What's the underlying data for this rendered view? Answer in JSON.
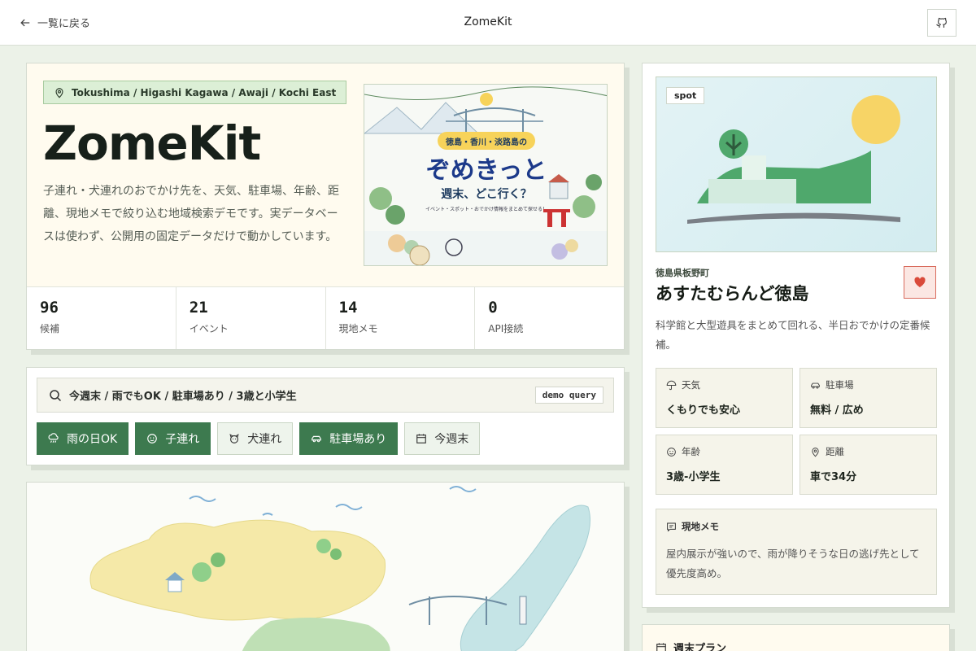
{
  "topbar": {
    "back_label": "一覧に戻る",
    "title": "ZomeKit"
  },
  "hero": {
    "region": "Tokushima / Higashi Kagawa / Awaji / Kochi East",
    "brand": "ZomeKit",
    "intro": "子連れ・犬連れのおでかけ先を、天気、駐車場、年齢、距離、現地メモで絞り込む地域検索デモです。実データベースは使わず、公開用の固定データだけで動かしています。",
    "art": {
      "badge": "徳島・香川・淡路島の",
      "title": "ぞめきっと",
      "subtitle": "週末、どこ行く？",
      "caption": "イベント・スポット・おでかけ情報をまとめて探せる！"
    },
    "stats": [
      {
        "value": "96",
        "label": "候補"
      },
      {
        "value": "21",
        "label": "イベント"
      },
      {
        "value": "14",
        "label": "現地メモ"
      },
      {
        "value": "0",
        "label": "API接続"
      }
    ]
  },
  "search": {
    "query": "今週末 / 雨でもOK / 駐車場あり / 3歳と小学生",
    "demo_label": "demo query",
    "chips": [
      {
        "label": "雨の日OK",
        "active": true,
        "icon": "rain-icon"
      },
      {
        "label": "子連れ",
        "active": true,
        "icon": "child-icon"
      },
      {
        "label": "犬連れ",
        "active": false,
        "icon": "dog-icon"
      },
      {
        "label": "駐車場あり",
        "active": true,
        "icon": "car-icon"
      },
      {
        "label": "今週末",
        "active": false,
        "icon": "calendar-icon"
      }
    ]
  },
  "detail": {
    "tag": "spot",
    "prefecture": "徳島県板野町",
    "name": "あすたむらんど徳島",
    "description": "科学館と大型遊具をまとめて回れる、半日おでかけの定番候補。",
    "info": [
      {
        "key": "天気",
        "value": "くもりでも安心",
        "icon": "umbrella-icon"
      },
      {
        "key": "駐車場",
        "value": "無料 / 広め",
        "icon": "car-icon"
      },
      {
        "key": "年齢",
        "value": "3歳-小学生",
        "icon": "child-icon"
      },
      {
        "key": "距離",
        "value": "車で34分",
        "icon": "location-pin-icon"
      }
    ],
    "memo": {
      "key": "現地メモ",
      "value": "屋内展示が強いので、雨が降りそうな日の逃げ先として優先度高め。"
    }
  },
  "plan": {
    "title": "週末プラン"
  },
  "colors": {
    "accent": "#3d7a4f",
    "background": "#ecf2e8",
    "favorite": "#d94a3a"
  }
}
